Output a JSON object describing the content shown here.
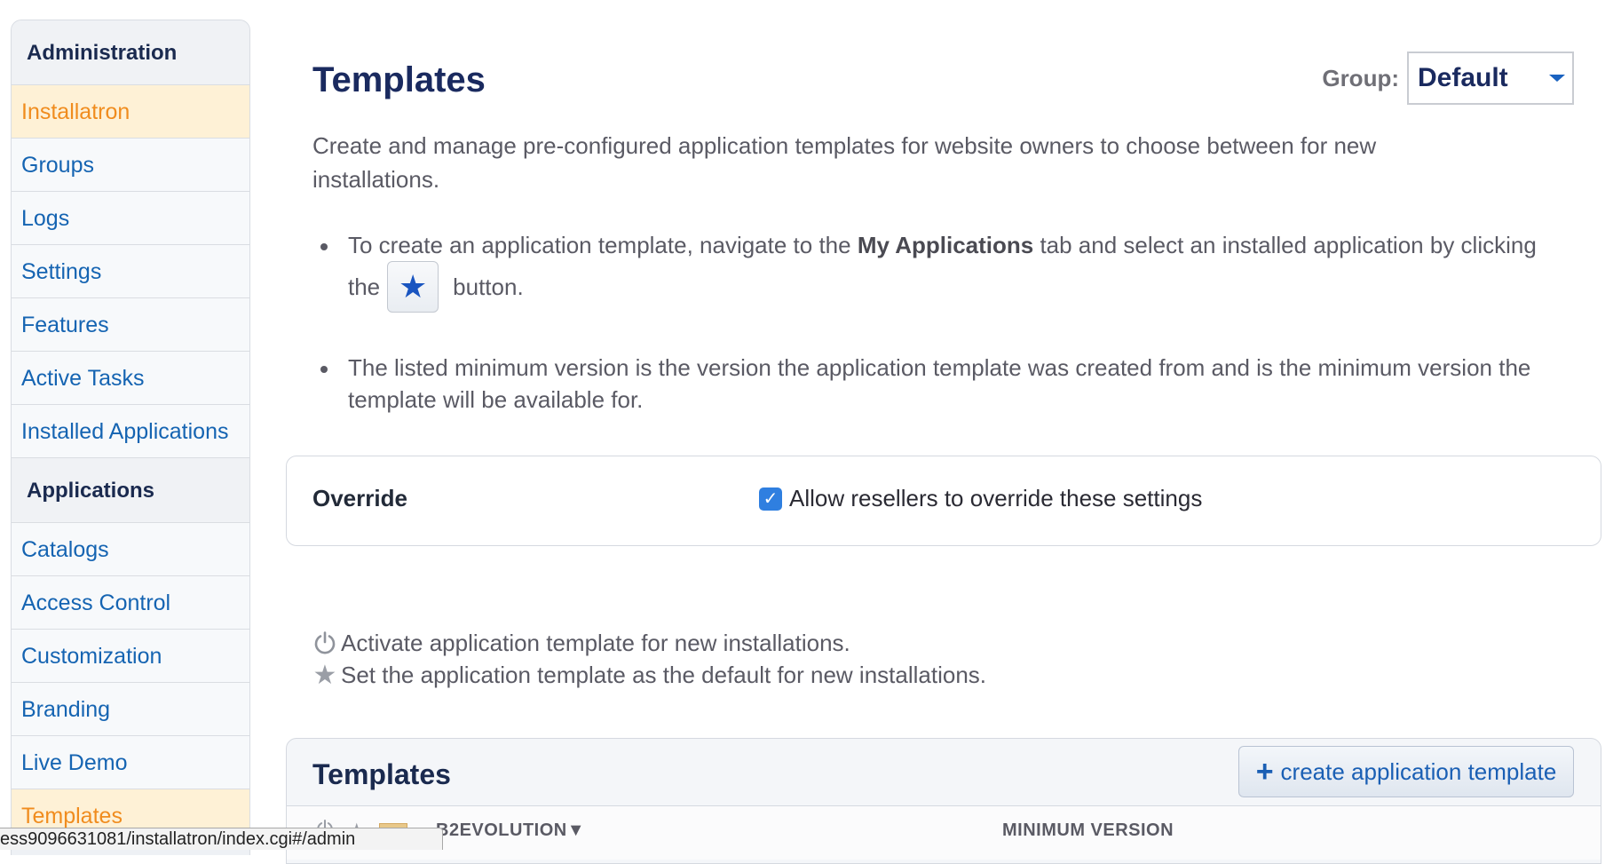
{
  "sidebar": {
    "sections": [
      {
        "heading": "Administration",
        "items": [
          {
            "label": "Installatron",
            "active": true
          },
          {
            "label": "Groups"
          },
          {
            "label": "Logs"
          },
          {
            "label": "Settings"
          },
          {
            "label": "Features"
          },
          {
            "label": "Active Tasks"
          },
          {
            "label": "Installed Applications"
          }
        ]
      },
      {
        "heading": "Applications",
        "items": [
          {
            "label": "Catalogs"
          },
          {
            "label": "Access Control"
          },
          {
            "label": "Customization"
          },
          {
            "label": "Branding"
          },
          {
            "label": "Live Demo"
          },
          {
            "label": "Templates",
            "active": true
          }
        ]
      }
    ]
  },
  "page": {
    "title": "Templates",
    "group_label": "Group:",
    "group_value": "Default",
    "description": "Create and manage pre-configured application templates for website owners to choose between for new installations.",
    "note1_before": "To create an application template, navigate to the ",
    "note1_bold": "My Applications",
    "note1_after": " tab and select an installed application by clicking",
    "note1_the": "the",
    "note1_button": "button.",
    "note2": "The listed minimum version is the version the application template was created from and is the minimum version the template will be available for."
  },
  "override": {
    "label": "Override",
    "checkbox_label": "Allow resellers to override these settings",
    "checked": true
  },
  "legend": {
    "activate": "Activate application template for new installations.",
    "default": "Set the application template as the default for new installations."
  },
  "templates_panel": {
    "title": "Templates",
    "create_button": "create application template",
    "columns": {
      "name": "B2EVOLUTION▼",
      "min_version": "MINIMUM VERSION"
    }
  },
  "statusbar": {
    "url": "ess9096631081/installatron/index.cgi#/admin"
  },
  "colors": {
    "link": "#1564b2",
    "active_text": "#f08c1e",
    "active_bg": "#fef1d6",
    "heading": "#1a2a5f",
    "checkbox": "#2f7fe0"
  }
}
